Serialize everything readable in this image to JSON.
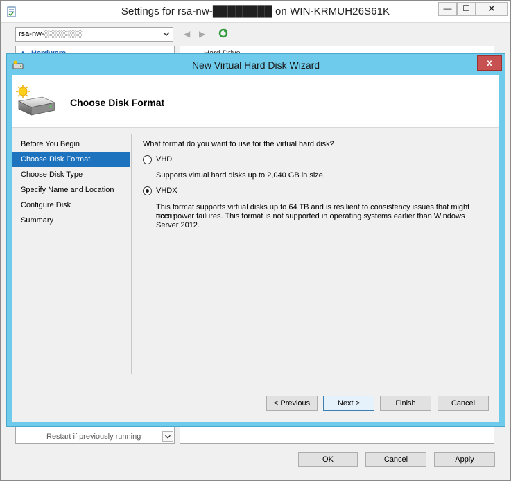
{
  "settings_window": {
    "title": "Settings for rsa-nw-████████ on WIN-KRMUH26S61K",
    "window_controls": {
      "minimize": "—",
      "maximize": "☐",
      "close": "✕"
    },
    "vm_selector": {
      "value": "rsa-nw-░░░░░░░"
    },
    "hardware_section_label": "Hardware",
    "details_partial_text": "Hard Drive",
    "restart_option": "Restart if previously running",
    "buttons": {
      "ok": "OK",
      "cancel": "Cancel",
      "apply": "Apply"
    }
  },
  "wizard": {
    "title": "New Virtual Hard Disk Wizard",
    "close_glyph": "x",
    "header_title": "Choose Disk Format",
    "steps": [
      {
        "label": "Before You Begin",
        "active": false
      },
      {
        "label": "Choose Disk Format",
        "active": true
      },
      {
        "label": "Choose Disk Type",
        "active": false
      },
      {
        "label": "Specify Name and Location",
        "active": false
      },
      {
        "label": "Configure Disk",
        "active": false
      },
      {
        "label": "Summary",
        "active": false
      }
    ],
    "question": "What format do you want to use for the virtual hard disk?",
    "options": {
      "vhd": {
        "label": "VHD",
        "checked": false,
        "description": "Supports virtual hard disks up to 2,040 GB in size."
      },
      "vhdx": {
        "label": "VHDX",
        "checked": true,
        "description_line1": "This format supports virtual disks up to 64 TB and is resilient to consistency issues that might occur",
        "description_line2": "from power failures. This format is not supported in operating systems earlier than Windows",
        "description_line3": "Server 2012."
      }
    },
    "buttons": {
      "previous": "< Previous",
      "next": "Next >",
      "finish": "Finish",
      "cancel": "Cancel"
    }
  },
  "colors": {
    "wizard_frame": "#6ecbeb",
    "active_step": "#1e73be",
    "close_button": "#c75050"
  }
}
